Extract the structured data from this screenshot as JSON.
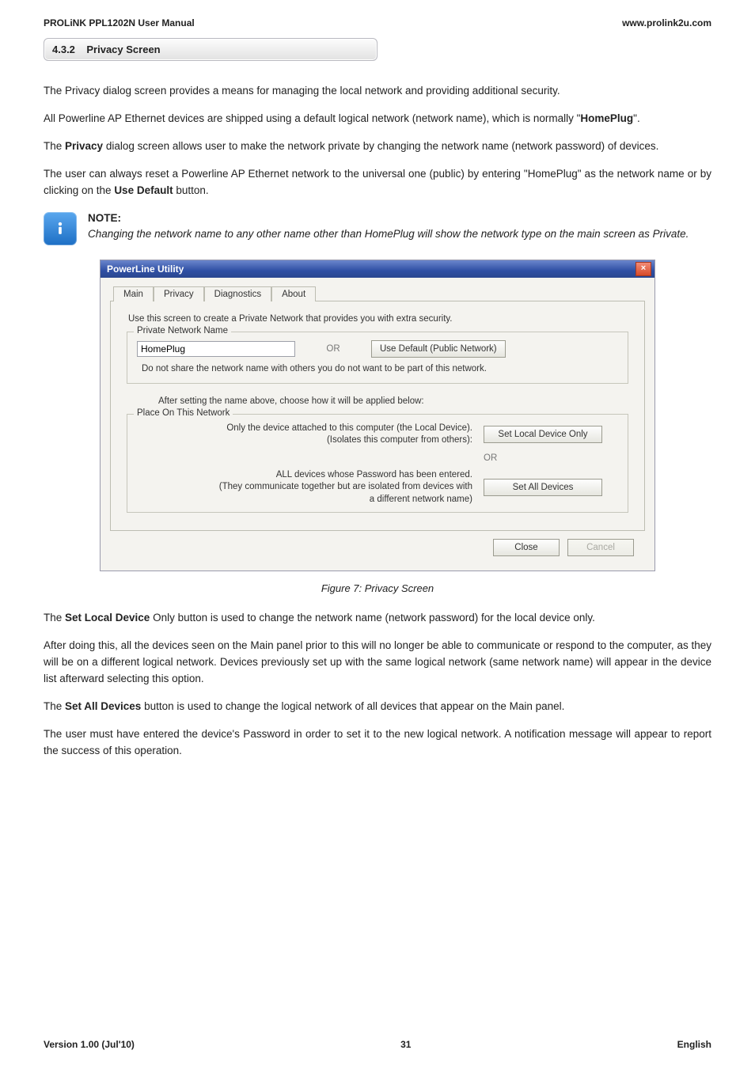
{
  "header": {
    "left": "PROLiNK PPL1202N User Manual",
    "right": "www.prolink2u.com"
  },
  "section": {
    "number": "4.3.2",
    "title": "Privacy Screen"
  },
  "paragraphs": {
    "p1": "The Privacy dialog screen provides a means for managing the local network and providing additional security.",
    "p2_pre": "All Powerline AP Ethernet devices are shipped using a default logical network (network name), which is normally \"",
    "p2_bold": "HomePlug",
    "p2_post": "\".",
    "p3_pre": "The ",
    "p3_bold": "Privacy",
    "p3_post": " dialog screen allows user to make the network private by changing the network name (network password) of devices.",
    "p4_pre": "The user can always reset a Powerline AP Ethernet network to the universal one (public) by entering \"HomePlug\" as the network name or by clicking on the ",
    "p4_bold": "Use Default",
    "p4_post": " button."
  },
  "note": {
    "label": "NOTE:",
    "text": "Changing the network name to any other name other than HomePlug will show the network type on the main screen as Private."
  },
  "dialog": {
    "title": "PowerLine Utility",
    "tabs": [
      "Main",
      "Privacy",
      "Diagnostics",
      "About"
    ],
    "activeTabIndex": 1,
    "intro": "Use this screen to create a Private Network that provides you with extra security.",
    "privateNetwork": {
      "legend": "Private Network Name",
      "value": "HomePlug",
      "or": "OR",
      "defaultBtn": "Use Default (Public Network)",
      "warn": "Do not share the network name with others you do not want to be part of this network."
    },
    "afterSetting": "After setting the name above, choose how it will be applied below:",
    "placeOn": {
      "legend": "Place On This Network",
      "localText1": "Only the device attached to this computer (the Local Device).",
      "localText2": "(Isolates this computer from others):",
      "localBtn": "Set Local Device Only",
      "or": "OR",
      "allText1": "ALL devices whose Password has been entered.",
      "allText2": "(They communicate together but are isolated from devices with",
      "allText3": "a different network name)",
      "allBtn": "Set All Devices"
    },
    "footer": {
      "close": "Close",
      "cancel": "Cancel"
    }
  },
  "figureCaption": "Figure 7: Privacy Screen",
  "post": {
    "p5_pre": "The ",
    "p5_bold": "Set Local Device",
    "p5_post": " Only button is used to change the network name (network password) for the local device only.",
    "p6": "After doing this, all the devices seen on the Main panel prior to this will no longer be able to communicate or respond to the computer, as they will be on a different logical network. Devices previously set up with the same logical network (same network name) will appear in the device list afterward selecting this option.",
    "p7_pre": "The ",
    "p7_bold": "Set All Devices",
    "p7_post": " button is used to change the logical network of all devices that appear on the Main panel.",
    "p8": "The user must have entered the device's Password in order to set it to the new logical network. A notification message will appear to report the success of this operation."
  },
  "footer": {
    "left": "Version 1.00 (Jul'10)",
    "center": "31",
    "right": "English"
  }
}
